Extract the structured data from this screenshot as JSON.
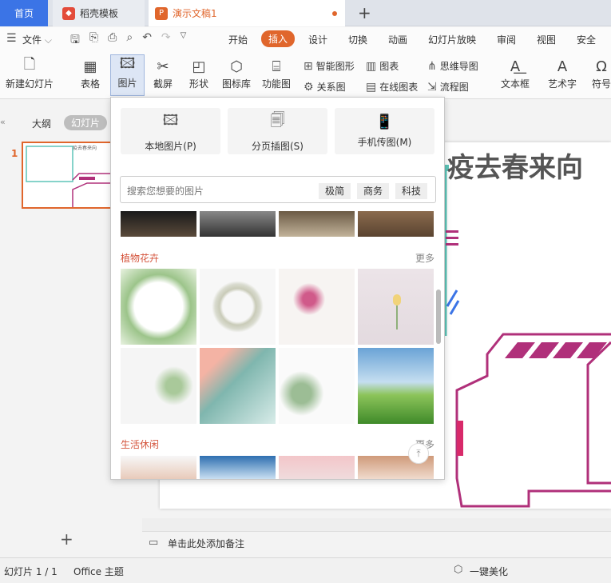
{
  "tabs": {
    "home": "首页",
    "template": "稻壳模板",
    "doc": "演示文稿1"
  },
  "menu": {
    "file": "文件",
    "items": [
      "开始",
      "插入",
      "设计",
      "切换",
      "动画",
      "幻灯片放映",
      "审阅",
      "视图",
      "安全"
    ],
    "active": "插入"
  },
  "ribbon": {
    "new_slide": "新建幻灯片",
    "table": "表格",
    "picture": "图片",
    "screenshot": "截屏",
    "shape": "形状",
    "icon_lib": "图标库",
    "func_chart": "功能图",
    "smart_shape": "智能图形",
    "chart": "图表",
    "mindmap": "思维导图",
    "relation": "关系图",
    "online_chart": "在线图表",
    "flowchart": "流程图",
    "textbox": "文本框",
    "art_text": "艺术字",
    "symbol": "符号"
  },
  "left_panel": {
    "outline_tab": "大纲",
    "slides_tab": "幻灯片",
    "slide_number": "1"
  },
  "slide": {
    "title": "疫去春来向"
  },
  "notes": {
    "placeholder": "单击此处添加备注"
  },
  "status": {
    "slide_info": "幻灯片 1 / 1",
    "theme": "Office 主题",
    "beautify": "一键美化"
  },
  "picture_panel": {
    "source_buttons": [
      "本地图片(P)",
      "分页插图(S)",
      "手机传图(M)"
    ],
    "search_placeholder": "搜索您想要的图片",
    "tags": [
      "极简",
      "商务",
      "科技"
    ],
    "section_plants": "植物花卉",
    "section_life": "生活休闲",
    "more": "更多"
  },
  "colors": {
    "accent": "#e0662c",
    "brand_blue": "#3b74e6",
    "section_red": "#d4543c"
  }
}
